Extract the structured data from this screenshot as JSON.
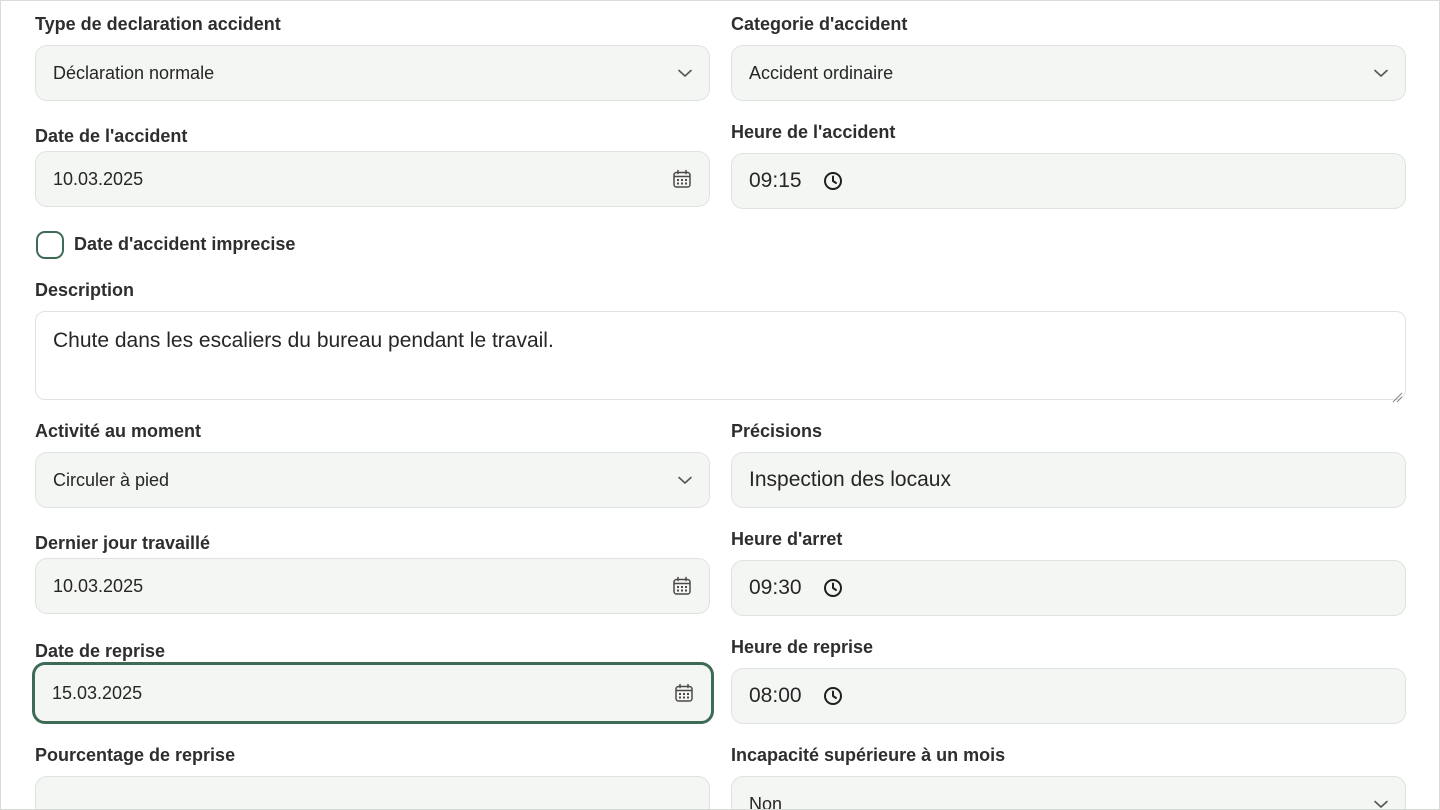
{
  "form": {
    "type_declaration": {
      "label": "Type de declaration accident",
      "value": "Déclaration normale"
    },
    "categorie": {
      "label": "Categorie d'accident",
      "value": "Accident ordinaire"
    },
    "date_accident": {
      "label": "Date de l'accident",
      "value": "10.03.2025"
    },
    "heure_accident": {
      "label": "Heure de l'accident",
      "value": "09:15"
    },
    "date_imprecise": {
      "label": "Date d'accident imprecise",
      "checked": false
    },
    "description": {
      "label": "Description",
      "value": "Chute dans les escaliers du bureau pendant le travail."
    },
    "activite": {
      "label": "Activité au moment",
      "value": "Circuler à pied"
    },
    "precisions": {
      "label": "Précisions",
      "value": "Inspection des locaux"
    },
    "dernier_jour": {
      "label": "Dernier jour travaillé",
      "value": "10.03.2025"
    },
    "heure_arret": {
      "label": "Heure d'arret",
      "value": "09:30"
    },
    "date_reprise": {
      "label": "Date de reprise",
      "value": "15.03.2025"
    },
    "heure_reprise": {
      "label": "Heure de reprise",
      "value": "08:00"
    },
    "pourcentage_reprise": {
      "label": "Pourcentage de reprise",
      "value": ""
    },
    "incapacite": {
      "label": "Incapacité supérieure à un mois",
      "value": "Non"
    }
  },
  "icons": {
    "dropdown": "chevron-down-icon",
    "date": "calendar-icon",
    "time": "clock-icon"
  },
  "colors": {
    "accent": "#3d6b55",
    "field_bg": "#f4f6f3",
    "field_border": "#dfe3df"
  }
}
